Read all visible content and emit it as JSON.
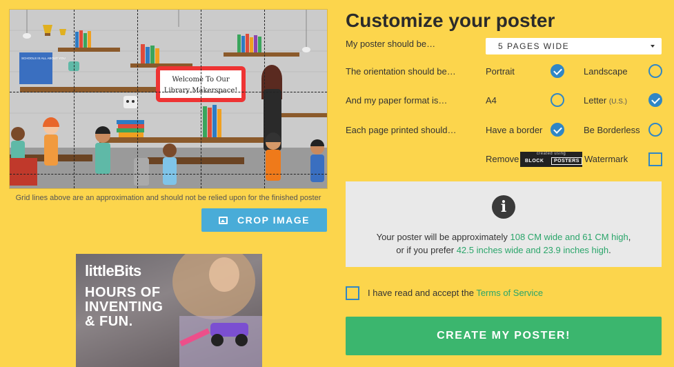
{
  "left": {
    "preview": {
      "banner_line1": "Welcome To Our",
      "banner_line2": "Library Makerspace!",
      "shelf_book_title": "SCHOOLS IS ALL ABOUT YOU"
    },
    "grid_note": "Grid lines above are an approximation and should not be relied upon for the finished poster",
    "crop_button": {
      "label": "CROP IMAGE",
      "icon": "image-icon"
    },
    "ad": {
      "brand": "littleBits",
      "headline": "HOURS OF\nINVENTING\n& FUN."
    }
  },
  "right": {
    "title": "Customize your poster",
    "size": {
      "label": "My poster should be…",
      "selected": "5 PAGES WIDE",
      "icon": "chevron-down-icon"
    },
    "orientation": {
      "label": "The orientation should be…",
      "options": [
        {
          "label": "Portrait",
          "checked": true
        },
        {
          "label": "Landscape",
          "checked": false
        }
      ]
    },
    "paper": {
      "label": "And my paper format is…",
      "options": [
        {
          "label": "A4",
          "checked": false
        },
        {
          "label": "Letter",
          "suffix": "(U.S.)",
          "checked": true
        }
      ]
    },
    "border": {
      "label": "Each page printed should…",
      "options": [
        {
          "label": "Have a border",
          "checked": true
        },
        {
          "label": "Be Borderless",
          "checked": false
        }
      ]
    },
    "watermark": {
      "before": "Remove",
      "after": "Watermark",
      "logo_created": "created using",
      "logo_word1": "BLOCK",
      "logo_word2": "POSTERS",
      "checked": false
    },
    "info": {
      "icon": "info-icon",
      "glyph": "i",
      "line1_prefix": "Your poster will be approximately ",
      "line1_highlight": "108 CM wide and 61 CM high",
      "line1_suffix": ",",
      "line2_prefix": "or if you prefer ",
      "line2_highlight": "42.5 inches wide and 23.9 inches high",
      "line2_suffix": "."
    },
    "tos": {
      "text": "I have read and accept the ",
      "link": "Terms of Service",
      "checked": false
    },
    "create_button": "CREATE MY POSTER!"
  },
  "colors": {
    "background": "#fcd54c",
    "accent_blue": "#2f86c6",
    "crop_blue": "#49acd8",
    "green": "#3bb66e",
    "link_green": "#2aa56a"
  }
}
